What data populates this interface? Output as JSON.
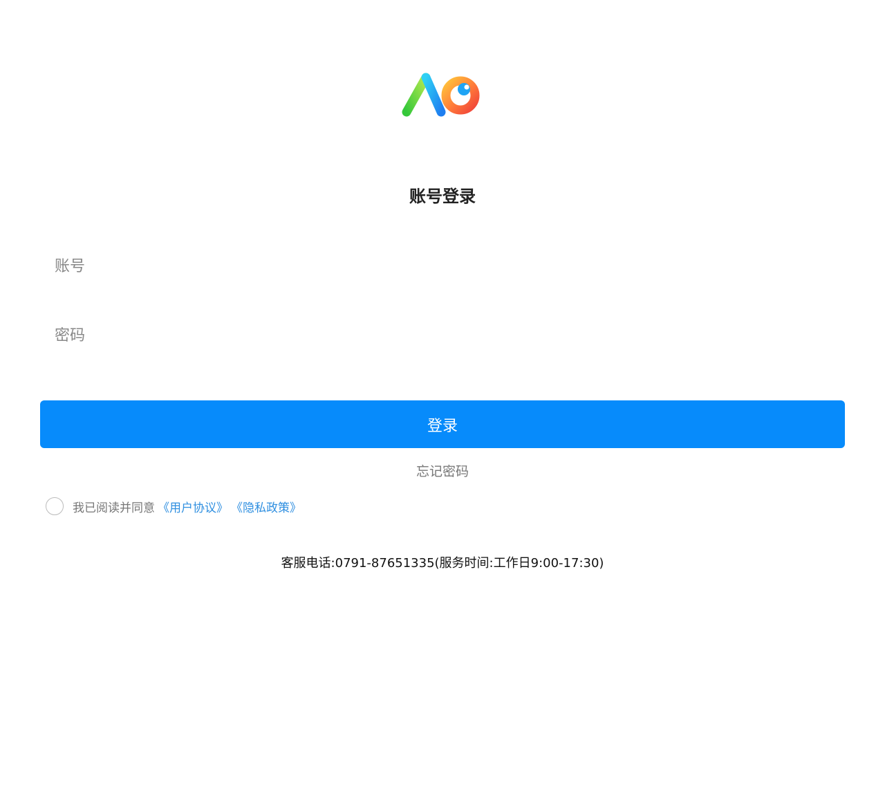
{
  "login": {
    "title": "账号登录",
    "account_placeholder": "账号",
    "password_placeholder": "密码",
    "submit_label": "登录",
    "forgot_label": "忘记密码"
  },
  "agreement": {
    "prefix": "我已阅读并同意",
    "user_agreement": "《用户协议》",
    "privacy_policy": "《隐私政策》"
  },
  "footer": {
    "service_text": "客服电话:0791-87651335(服务时间:工作日9:00-17:30)"
  },
  "colors": {
    "primary": "#078bfb",
    "link": "#2f8fe0"
  }
}
